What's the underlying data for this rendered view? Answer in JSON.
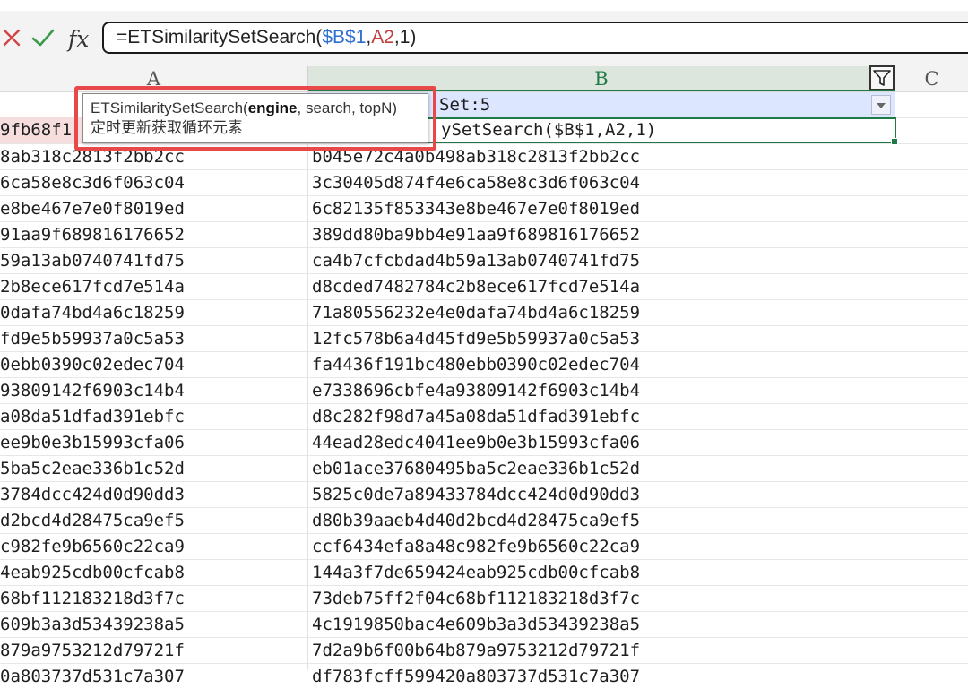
{
  "formula_bar": {
    "formula_prefix": "=ETSimilaritySetSearch(",
    "formula_ref1": "$B$1",
    "formula_sep1": ",",
    "formula_ref2": "A2",
    "formula_suffix": ",1)"
  },
  "columns": [
    "A",
    "B",
    "C"
  ],
  "header_row": {
    "b_text": "Set:5",
    "b_formula_text": "ySetSearch($B$1,A2,1)",
    "a_text": "9fb68f1"
  },
  "tooltip": {
    "func": "ETSimilaritySetSearch(",
    "param_bold": "engine",
    "params_rest": ", search, topN)",
    "description": "定时更新获取循环元素"
  },
  "rows": [
    {
      "a": "8ab318c2813f2bb2cc",
      "b": "b045e72c4a0b498ab318c2813f2bb2cc"
    },
    {
      "a": "6ca58e8c3d6f063c04",
      "b": "3c30405d874f4e6ca58e8c3d6f063c04"
    },
    {
      "a": "e8be467e7e0f8019ed",
      "b": "6c82135f853343e8be467e7e0f8019ed"
    },
    {
      "a": "91aa9f689816176652",
      "b": "389dd80ba9bb4e91aa9f689816176652"
    },
    {
      "a": "59a13ab0740741fd75",
      "b": "ca4b7cfcbdad4b59a13ab0740741fd75"
    },
    {
      "a": "2b8ece617fcd7e514a",
      "b": "d8cded7482784c2b8ece617fcd7e514a"
    },
    {
      "a": "0dafa74bd4a6c18259",
      "b": "71a80556232e4e0dafa74bd4a6c18259"
    },
    {
      "a": "fd9e5b59937a0c5a53",
      "b": "12fc578b6a4d45fd9e5b59937a0c5a53"
    },
    {
      "a": "0ebb0390c02edec704",
      "b": "fa4436f191bc480ebb0390c02edec704"
    },
    {
      "a": "93809142f6903c14b4",
      "b": "e7338696cbfe4a93809142f6903c14b4"
    },
    {
      "a": "a08da51dfad391ebfc",
      "b": "d8c282f98d7a45a08da51dfad391ebfc"
    },
    {
      "a": "ee9b0e3b15993cfa06",
      "b": "44ead28edc4041ee9b0e3b15993cfa06"
    },
    {
      "a": "5ba5c2eae336b1c52d",
      "b": "eb01ace37680495ba5c2eae336b1c52d"
    },
    {
      "a": "3784dcc424d0d90dd3",
      "b": "5825c0de7a89433784dcc424d0d90dd3"
    },
    {
      "a": "d2bcd4d28475ca9ef5",
      "b": "d80b39aaeb4d40d2bcd4d28475ca9ef5"
    },
    {
      "a": "c982fe9b6560c22ca9",
      "b": "ccf6434efa8a48c982fe9b6560c22ca9"
    },
    {
      "a": "4eab925cdb00cfcab8",
      "b": "144a3f7de659424eab925cdb00cfcab8"
    },
    {
      "a": "68bf112183218d3f7c",
      "b": "73deb75ff2f04c68bf112183218d3f7c"
    },
    {
      "a": "609b3a3d53439238a5",
      "b": "4c1919850bac4e609b3a3d53439238a5"
    },
    {
      "a": "879a9753212d79721f",
      "b": "7d2a9b6f00b64b879a9753212d79721f"
    },
    {
      "a": "0a803737d531c7a307",
      "b": "df783fcff599420a803737d531c7a307"
    }
  ],
  "colors": {
    "active_column": "#1f7a47",
    "header_selection": "#dde6ff",
    "highlight_box": "#e8484a",
    "formula_ref_b": "#2f6fd1",
    "formula_ref_a": "#c43c3c"
  }
}
